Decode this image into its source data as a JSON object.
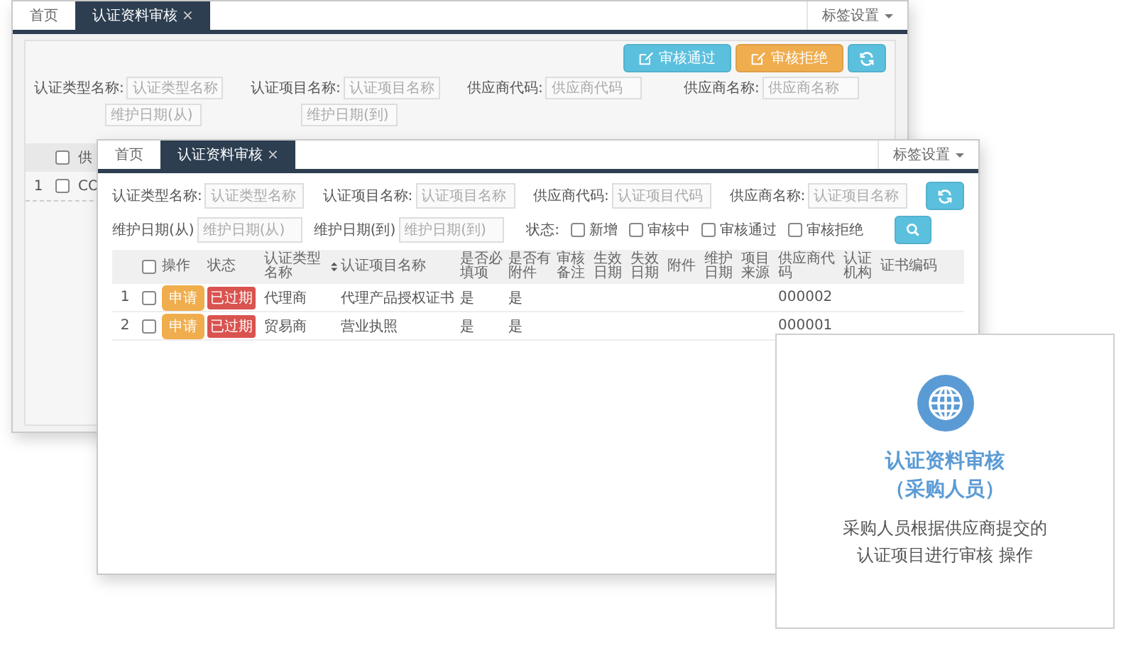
{
  "back_window": {
    "tabs": [
      {
        "label": "首页",
        "selected": false
      },
      {
        "label": "认证资料审核",
        "selected": true,
        "close_symbol": "×"
      }
    ],
    "tab_settings": "标签设置",
    "toolbar_buttons": [
      {
        "kind": "approve",
        "label": "审核通过"
      },
      {
        "kind": "reject",
        "label": "审核拒绝"
      },
      {
        "kind": "refresh"
      }
    ],
    "fields": [
      {
        "label": "认证类型名称:",
        "placeholder": "认证类型名称"
      },
      {
        "label": "认证项目名称:",
        "placeholder": "认证项目名称"
      },
      {
        "label": "供应商代码:",
        "placeholder": "供应商代码"
      },
      {
        "label": "供应商名称:",
        "placeholder": "供应商名称"
      }
    ],
    "date_fields": [
      {
        "placeholder": "维护日期(从)"
      },
      {
        "placeholder": "维护日期(到)"
      }
    ],
    "table": {
      "header_checked": false,
      "column_1": "供",
      "rows": [
        {
          "index": "1",
          "checked": false,
          "column_1": "CO"
        }
      ]
    }
  },
  "front_window": {
    "tabs": [
      {
        "label": "首页",
        "selected": false
      },
      {
        "label": "认证资料审核",
        "selected": true,
        "close_symbol": "×"
      }
    ],
    "tab_settings": "标签设置",
    "fields": [
      {
        "label": "认证类型名称:",
        "placeholder": "认证类型名称"
      },
      {
        "label": "认证项目名称:",
        "placeholder": "认证项目名称"
      },
      {
        "label": "供应商代码:",
        "placeholder": "认证项目代码"
      },
      {
        "label": "供应商名称:",
        "placeholder": "认证项目名称"
      }
    ],
    "date_fields": [
      {
        "label": "维护日期(从)",
        "placeholder": "维护日期(从)"
      },
      {
        "label": "维护日期(到)",
        "placeholder": "维护日期(到)"
      }
    ],
    "status_label": "状态:",
    "status_filters": [
      {
        "label": "新增",
        "checked": false
      },
      {
        "label": "审核中",
        "checked": false
      },
      {
        "label": "审核通过",
        "checked": false
      },
      {
        "label": "审核拒绝",
        "checked": false
      }
    ],
    "table": {
      "header_checked": false,
      "columns": [
        {
          "label": "操作",
          "sortable": false
        },
        {
          "label": "状态",
          "sortable": false
        },
        {
          "label": "认证类型名称",
          "sortable": true
        },
        {
          "label": "认证项目名称",
          "sortable": false
        },
        {
          "label": "是否必填项",
          "sortable": false
        },
        {
          "label": "是否有附件",
          "sortable": false
        },
        {
          "label": "审核备注",
          "sortable": false
        },
        {
          "label": "生效日期",
          "sortable": false
        },
        {
          "label": "失效日期",
          "sortable": false
        },
        {
          "label": "附件",
          "sortable": false
        },
        {
          "label": "维护日期",
          "sortable": false
        },
        {
          "label": "项目来源",
          "sortable": false
        },
        {
          "label": "供应商代码",
          "sortable": false
        },
        {
          "label": "认证机构",
          "sortable": false
        },
        {
          "label": "证书编码",
          "sortable": false
        }
      ],
      "rows": [
        {
          "index": "1",
          "checked": false,
          "action": "申请",
          "status": "已过期",
          "type_name": "代理商",
          "item_name": "代理产品授权证书",
          "required": "是",
          "has_attachment": "是",
          "supplier_code": "000002"
        },
        {
          "index": "2",
          "checked": false,
          "action": "申请",
          "status": "已过期",
          "type_name": "贸易商",
          "item_name": "营业执照",
          "required": "是",
          "has_attachment": "是",
          "supplier_code": "000001"
        }
      ]
    }
  },
  "feature_card": {
    "title": "认证资料审核",
    "subtitle": "（采购人员）",
    "description": "采购人员根据供应商提交的认证项目进行审核 操作"
  }
}
